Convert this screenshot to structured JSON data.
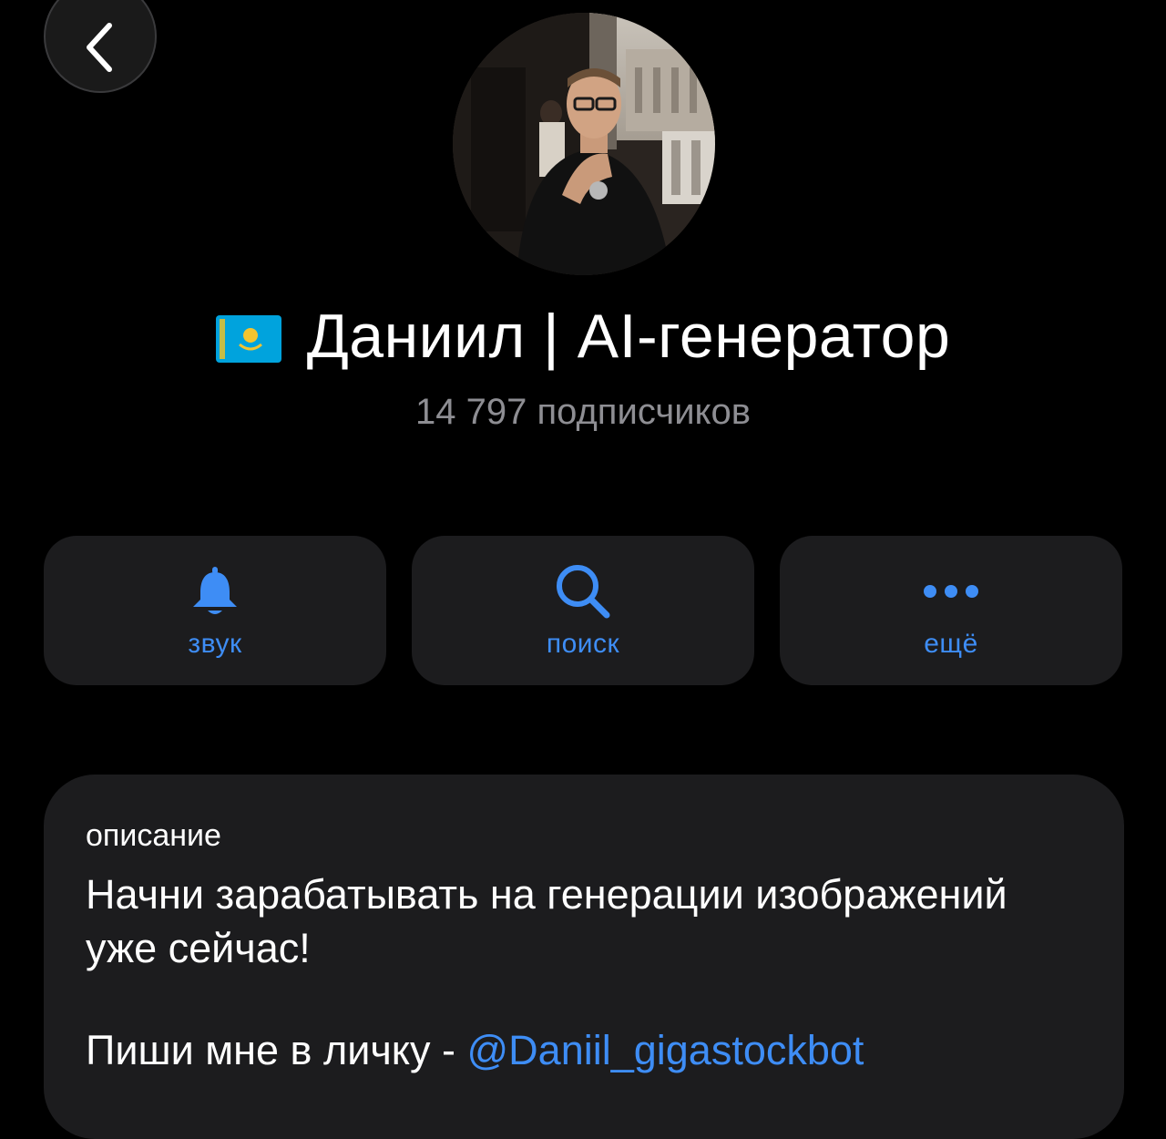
{
  "header": {
    "back_icon": "chevron-left-icon"
  },
  "profile": {
    "flag_icon": "kazakhstan-flag-icon",
    "name": "Даниил | AI-генератор",
    "subscribers": "14 797 подписчиков"
  },
  "actions": [
    {
      "icon": "bell-icon",
      "label": "звук"
    },
    {
      "icon": "search-icon",
      "label": "поиск"
    },
    {
      "icon": "more-dots-icon",
      "label": "ещё"
    }
  ],
  "description": {
    "caption": "описание",
    "text": "Начни зарабатывать на генерации изображений уже сейчас!",
    "contact_prefix": "Пиши мне в личку - ",
    "contact_link": "@Daniil_gigastockbot"
  },
  "colors": {
    "background": "#000000",
    "surface": "#1c1c1e",
    "accent": "#3e8df5",
    "secondary_text": "#8e8e93"
  }
}
